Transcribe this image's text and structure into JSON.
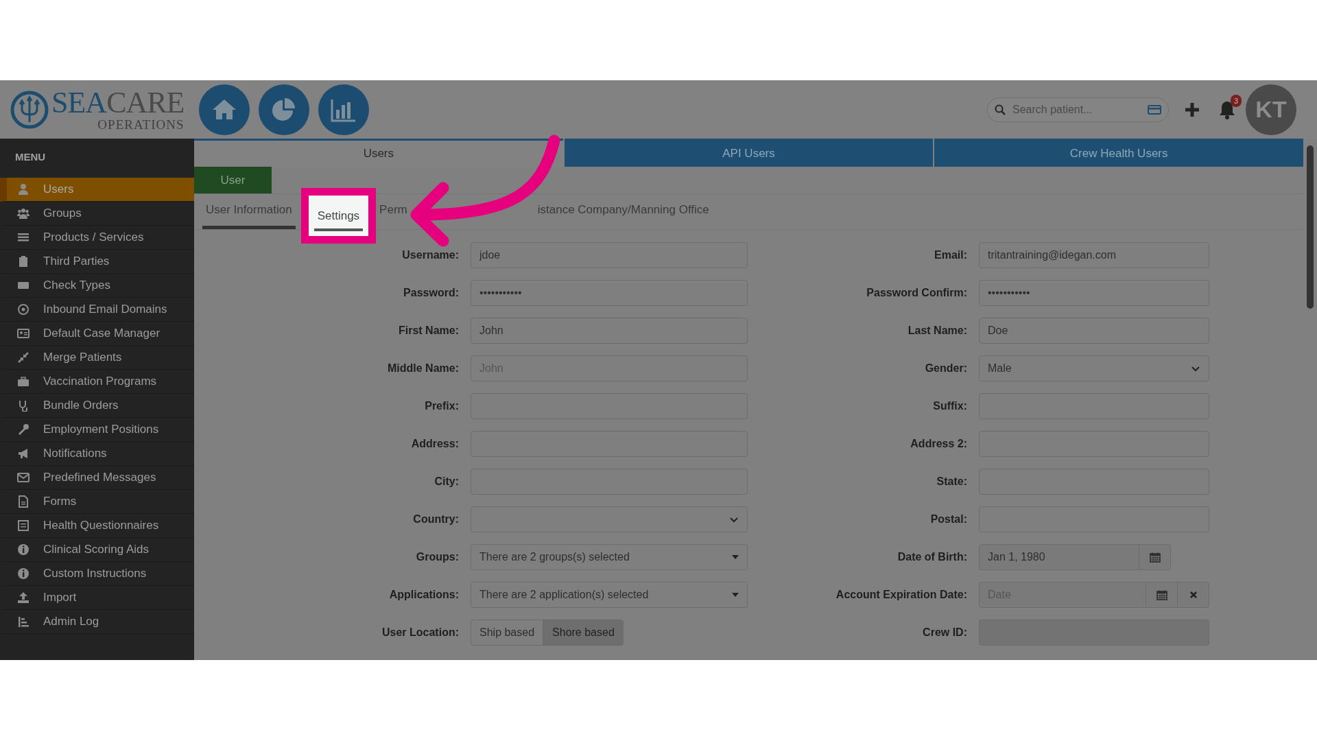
{
  "header": {
    "logo": {
      "part_1": "SEA",
      "part_2": "CARE",
      "tagline": "OPERATIONS"
    },
    "search": {
      "placeholder": "Search patient..."
    },
    "notification_count": "3",
    "avatar_initials": "KT"
  },
  "sidebar": {
    "title": "MENU",
    "items": [
      {
        "label": "Users",
        "selected": true
      },
      {
        "label": "Groups",
        "selected": false
      },
      {
        "label": "Products / Services",
        "selected": false
      },
      {
        "label": "Third Parties",
        "selected": false
      },
      {
        "label": "Check Types",
        "selected": false
      },
      {
        "label": "Inbound Email Domains",
        "selected": false
      },
      {
        "label": "Default Case Manager",
        "selected": false
      },
      {
        "label": "Merge Patients",
        "selected": false
      },
      {
        "label": "Vaccination Programs",
        "selected": false
      },
      {
        "label": "Bundle Orders",
        "selected": false
      },
      {
        "label": "Employment Positions",
        "selected": false
      },
      {
        "label": "Notifications",
        "selected": false
      },
      {
        "label": "Predefined Messages",
        "selected": false
      },
      {
        "label": "Forms",
        "selected": false
      },
      {
        "label": "Health Questionnaires",
        "selected": false
      },
      {
        "label": "Clinical Scoring Aids",
        "selected": false
      },
      {
        "label": "Custom Instructions",
        "selected": false
      },
      {
        "label": "Import",
        "selected": false
      },
      {
        "label": "Admin Log",
        "selected": false
      }
    ]
  },
  "top_tabs": [
    {
      "label": "Users",
      "selected": true
    },
    {
      "label": "API Users",
      "selected": false
    },
    {
      "label": "Crew Health Users",
      "selected": false
    }
  ],
  "section_button": "User",
  "sub_tabs": [
    {
      "label": "User Information",
      "selected": true,
      "highlighted": false
    },
    {
      "label": "Settings",
      "selected": true,
      "highlighted": true
    },
    {
      "label": "Perm",
      "selected": false,
      "highlighted": false
    },
    {
      "label": "istance Company/Manning Office",
      "selected": false,
      "highlighted": false
    }
  ],
  "form": {
    "left": [
      {
        "label": "Username:",
        "kind": "text",
        "value": "jdoe"
      },
      {
        "label": "Password:",
        "kind": "text",
        "value": "•••••••••••"
      },
      {
        "label": "First Name:",
        "kind": "text",
        "value": "John"
      },
      {
        "label": "Middle Name:",
        "kind": "text",
        "placeholder": "John"
      },
      {
        "label": "Prefix:",
        "kind": "text"
      },
      {
        "label": "Address:",
        "kind": "text"
      },
      {
        "label": "City:",
        "kind": "text"
      },
      {
        "label": "Country:",
        "kind": "select"
      },
      {
        "label": "Groups:",
        "kind": "multiselect",
        "value": "There are 2 groups(s) selected"
      },
      {
        "label": "Applications:",
        "kind": "multiselect",
        "value": "There are 2 application(s) selected"
      },
      {
        "label": "User Location:",
        "kind": "toggle",
        "options": [
          {
            "label": "Ship based",
            "selected": false
          },
          {
            "label": "Shore based",
            "selected": true
          }
        ]
      }
    ],
    "right": [
      {
        "label": "Email:",
        "kind": "text",
        "value": "tritantraining@idegan.com"
      },
      {
        "label": "Password Confirm:",
        "kind": "text",
        "value": "•••••••••••"
      },
      {
        "label": "Last Name:",
        "kind": "text",
        "value": "Doe"
      },
      {
        "label": "Gender:",
        "kind": "select",
        "value": "Male"
      },
      {
        "label": "Suffix:",
        "kind": "text"
      },
      {
        "label": "Address 2:",
        "kind": "text"
      },
      {
        "label": "State:",
        "kind": "text"
      },
      {
        "label": "Postal:",
        "kind": "text"
      },
      {
        "label": "Date of Birth:",
        "kind": "date",
        "value": "Jan 1, 1980"
      },
      {
        "label": "Account Expiration Date:",
        "kind": "date_clear",
        "placeholder": "Date"
      },
      {
        "label": "Crew ID:",
        "kind": "text",
        "disabled": true
      }
    ]
  }
}
